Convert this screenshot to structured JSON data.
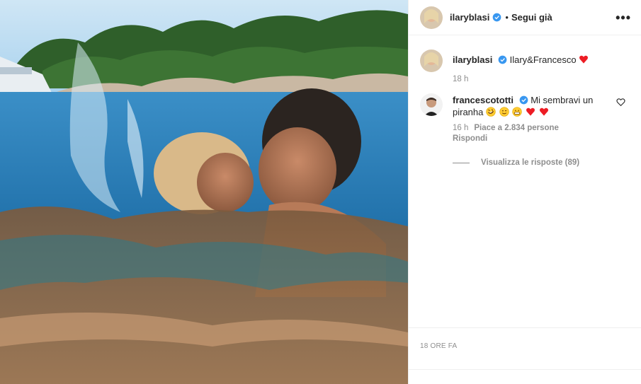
{
  "post": {
    "author": "ilaryblasi",
    "separator": "•",
    "follow_label": "Segui già",
    "more_label": "•••",
    "caption_author": "ilaryblasi",
    "caption_text": "Ilary&Francesco",
    "caption_emoji": "heart",
    "caption_time": "18 h",
    "time_ago": "18 ORE FA"
  },
  "comment": {
    "author": "francescototti",
    "text": "Mi sembravi un piranha",
    "emojis": [
      "rofl-emoji",
      "wink-emoji",
      "grin-emoji",
      "heart-emoji",
      "heart-emoji"
    ],
    "time": "16 h",
    "likes": "Piace a 2.834 persone",
    "reply_label": "Rispondi",
    "view_replies": "Visualizza le risposte (89)"
  },
  "colors": {
    "verified": "#3897f0",
    "heart": "#ed1c24",
    "muted": "#8e8e8e",
    "text": "#262626"
  }
}
